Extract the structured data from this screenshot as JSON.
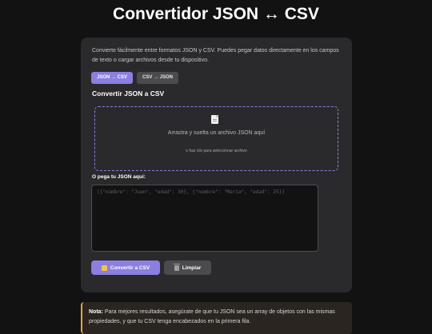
{
  "header": {
    "title": "Convertidor JSON ↔ CSV"
  },
  "card": {
    "description": "Convierte fácilmente entre formatos JSON y CSV. Puedes pegar datos directamente en los campos de texto o cargar archivos desde tu dispositivo.",
    "tabs": [
      {
        "label": "JSON → CSV",
        "active": true
      },
      {
        "label": "CSV → JSON",
        "active": false
      }
    ],
    "section_title": "Convertir JSON a CSV",
    "dropzone": {
      "icon": "document-icon",
      "main_text": "Arrastra y suelta un archivo JSON aquí",
      "sub_text": "o haz clic para seleccionar archivo"
    },
    "json_input": {
      "label": "O pega tu JSON aquí:",
      "value": "",
      "placeholder": "[{\"nombre\": \"Juan\", \"edad\": 30}, {\"nombre\": \"María\", \"edad\": 25}]"
    },
    "buttons": {
      "convert_label": "Convertir a CSV",
      "convert_icon": "convert-icon",
      "clear_label": "Limpiar",
      "clear_icon": "trash-icon"
    }
  },
  "note": {
    "strong": "Nota:",
    "text": " Para mejores resultados, asegúrate de que tu JSON sea un array de objetos con las mismas propiedades, y que tu CSV tenga encabezados en la primera fila."
  },
  "colors": {
    "accent": "#8b7fe0",
    "background": "#121212",
    "card": "#2a2a2c",
    "note_border": "#e3a546"
  }
}
